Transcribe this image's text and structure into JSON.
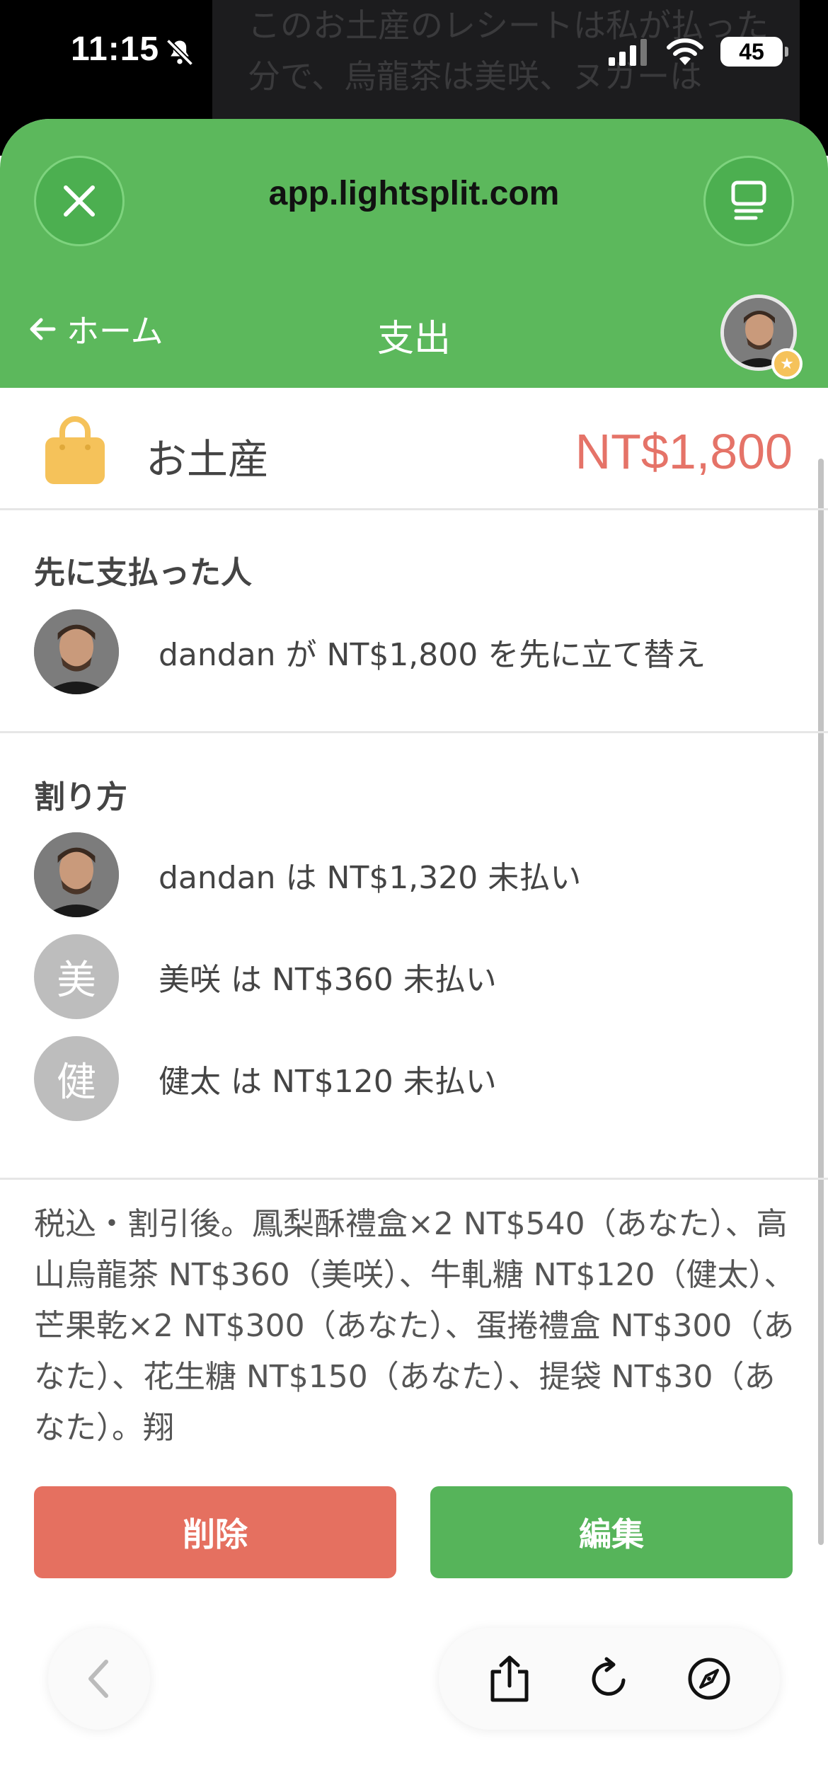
{
  "status_bar": {
    "time": "11:15",
    "battery": "45"
  },
  "background_chat": {
    "text": "このお土産のレシートは私が払った分で、烏龍茶は美咲、ヌガーは"
  },
  "browser": {
    "url": "app.lightsplit.com"
  },
  "nav": {
    "back_label": "ホーム",
    "title": "支出"
  },
  "expense": {
    "name": "お土産",
    "amount": "NT$1,800"
  },
  "paid_by": {
    "title": "先に支払った人",
    "text": "dandan が NT$1,800 を先に立て替え"
  },
  "split": {
    "title": "割り方",
    "rows": [
      {
        "avatar_letter": "",
        "text": "dandan は NT$1,320 未払い"
      },
      {
        "avatar_letter": "美",
        "text": "美咲 は NT$360 未払い"
      },
      {
        "avatar_letter": "健",
        "text": "健太 は NT$120 未払い"
      }
    ]
  },
  "note": "税込・割引後。鳳梨酥禮盒×2 NT$540（あなた）、高山烏龍茶 NT$360（美咲）、牛軋糖 NT$120（健太）、芒果乾×2 NT$300（あなた）、蛋捲禮盒 NT$300（あなた）、花生糖 NT$150（あなた）、提袋 NT$30（あなた）。翔",
  "actions": {
    "delete_label": "削除",
    "edit_label": "編集"
  },
  "colors": {
    "header_green": "#5cb85c",
    "amount_red": "#e57368",
    "delete_red": "#e57060",
    "edit_green": "#56b45a",
    "bag_yellow": "#f5c25a"
  }
}
